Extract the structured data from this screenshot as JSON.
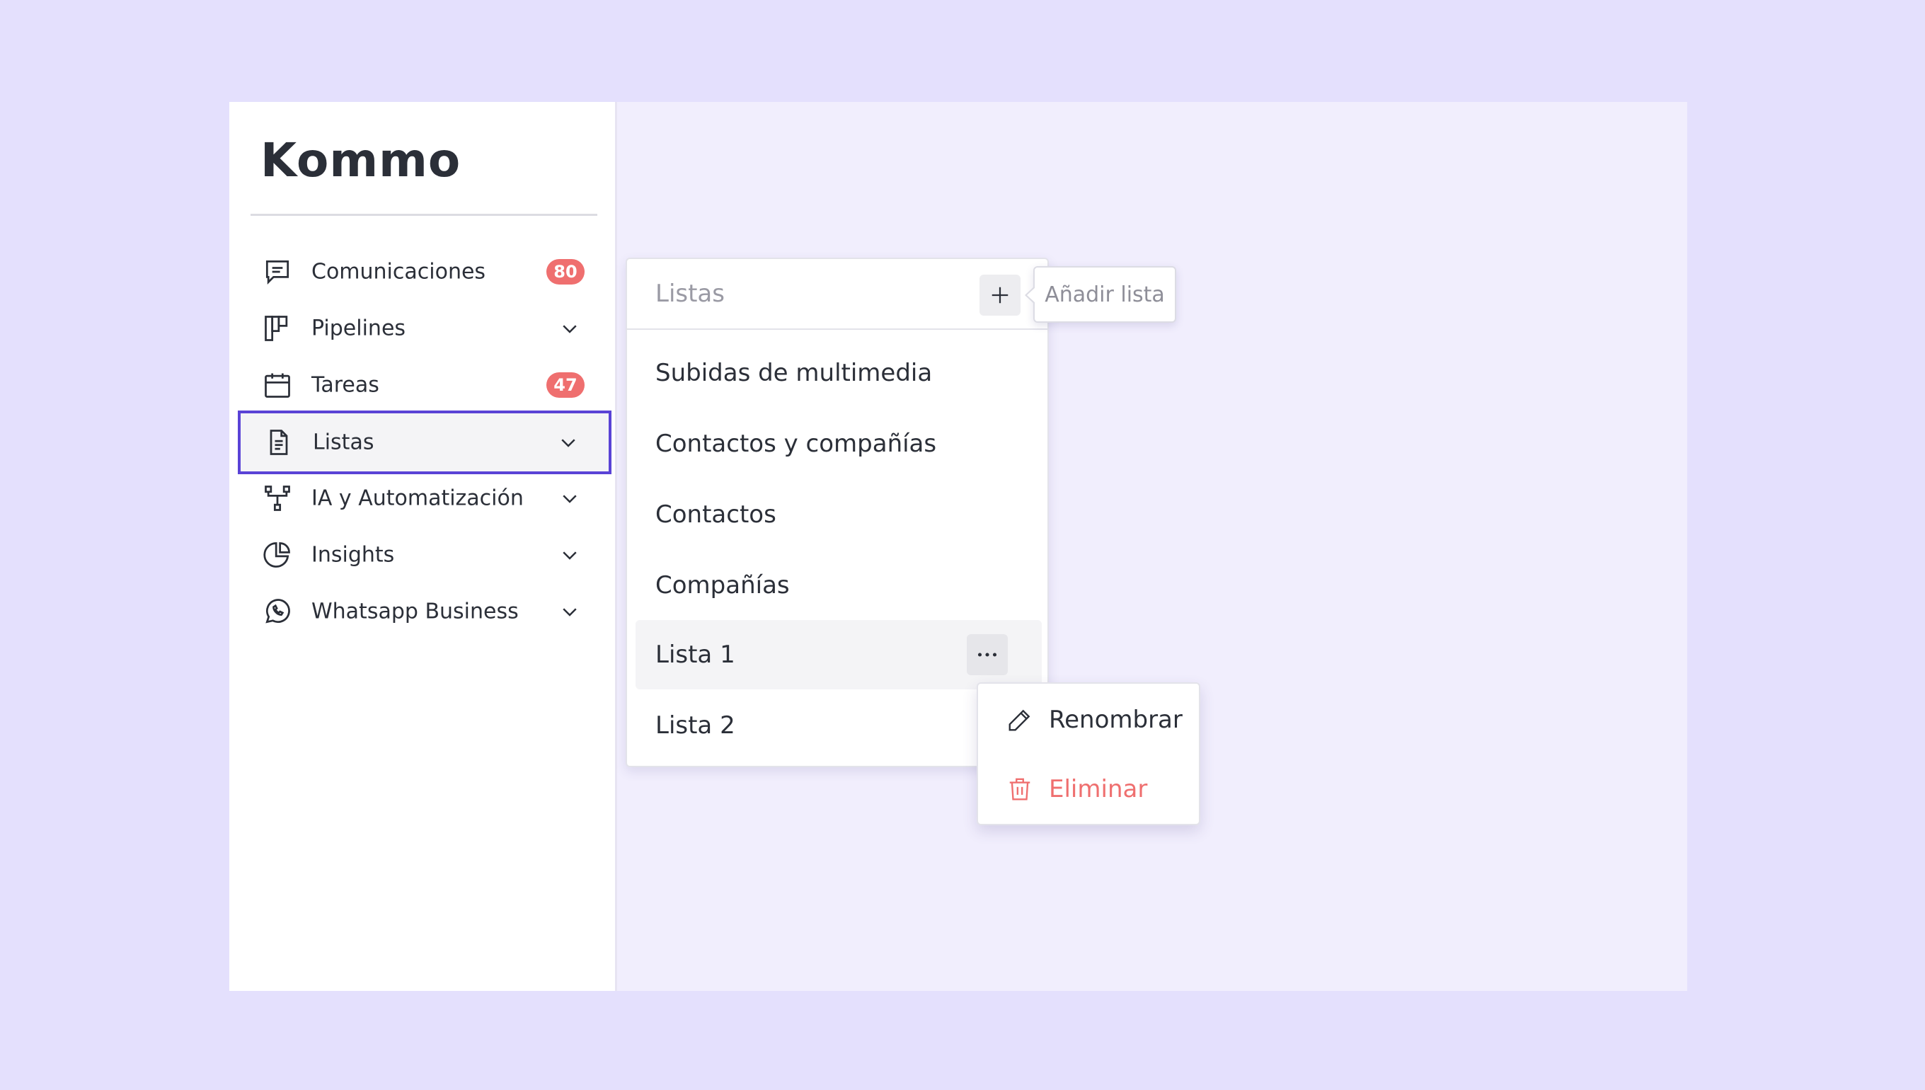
{
  "brand": {
    "logo_text": "Kommo"
  },
  "sidebar": {
    "items": [
      {
        "label": "Comunicaciones",
        "icon": "chat-icon",
        "badge": "80"
      },
      {
        "label": "Pipelines",
        "icon": "pipelines-icon"
      },
      {
        "label": "Tareas",
        "icon": "calendar-icon",
        "badge": "47"
      },
      {
        "label": "Listas",
        "icon": "document-icon",
        "active": true
      },
      {
        "label": "IA y Automatización",
        "icon": "automation-icon"
      },
      {
        "label": "Insights",
        "icon": "pie-chart-icon"
      },
      {
        "label": "Whatsapp Business",
        "icon": "whatsapp-icon"
      }
    ]
  },
  "lists_panel": {
    "title": "Listas",
    "add_tooltip": "Añadir lista",
    "items": [
      {
        "label": "Subidas de multimedia"
      },
      {
        "label": "Contactos y compañías"
      },
      {
        "label": "Contactos"
      },
      {
        "label": "Compañías"
      },
      {
        "label": "Lista 1"
      },
      {
        "label": "Lista 2"
      }
    ]
  },
  "context_menu": {
    "items": [
      {
        "label": "Renombrar",
        "icon": "pencil-icon"
      },
      {
        "label": "Eliminar",
        "icon": "trash-icon",
        "color": "#ef6f6f"
      }
    ]
  },
  "colors": {
    "background": "#e4e0fd",
    "accent": "#5a43d6",
    "badge": "#ef6f6f",
    "danger": "#ef6f6f"
  }
}
